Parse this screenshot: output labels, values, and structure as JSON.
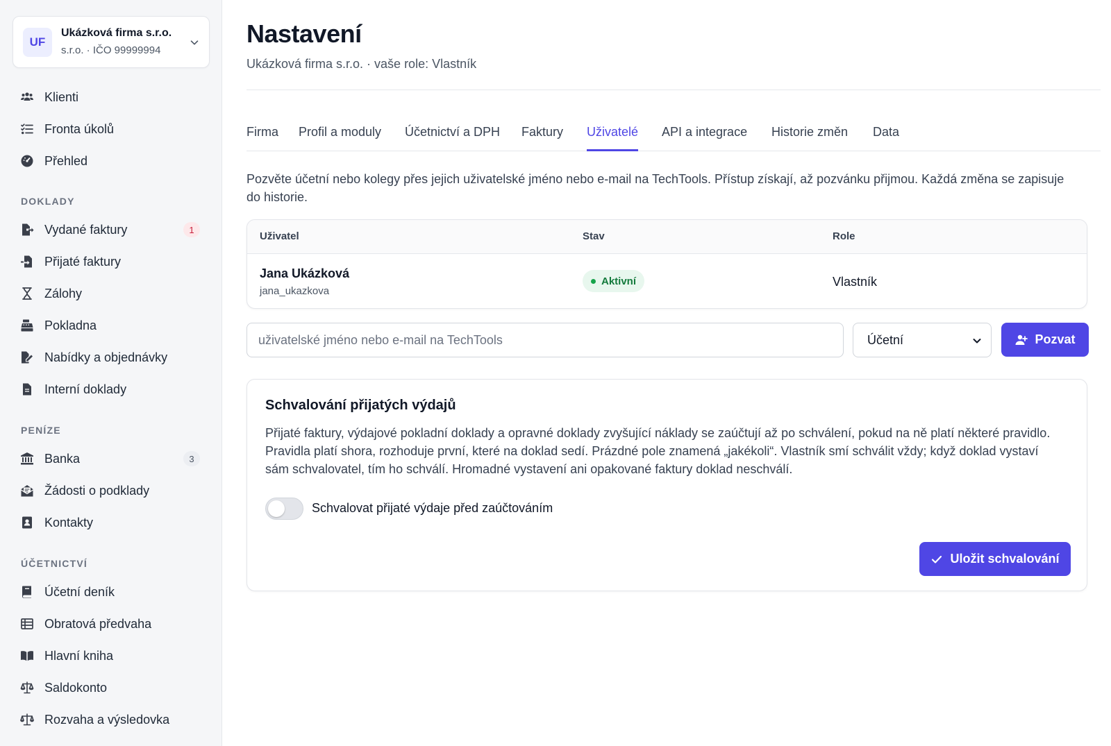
{
  "org": {
    "initials": "UF",
    "name": "Ukázková firma s.r.o.",
    "subtitle": "s.r.o. · IČO 99999994"
  },
  "sidebar": {
    "top_items": [
      {
        "label": "Klienti",
        "icon": "users-icon"
      },
      {
        "label": "Fronta úkolů",
        "icon": "task-list-icon"
      },
      {
        "label": "Přehled",
        "icon": "gauge-icon"
      }
    ],
    "sections": [
      {
        "title": "DOKLADY",
        "items": [
          {
            "label": "Vydané faktury",
            "icon": "file-export-icon",
            "badge": "1"
          },
          {
            "label": "Přijaté faktury",
            "icon": "file-import-icon"
          },
          {
            "label": "Zálohy",
            "icon": "hourglass-icon"
          },
          {
            "label": "Pokladna",
            "icon": "cash-register-icon"
          },
          {
            "label": "Nabídky a objednávky",
            "icon": "file-signature-icon"
          },
          {
            "label": "Interní doklady",
            "icon": "document-icon"
          }
        ]
      },
      {
        "title": "PENÍZE",
        "items": [
          {
            "label": "Banka",
            "icon": "bank-icon",
            "badge": "3"
          },
          {
            "label": "Žádosti o podklady",
            "icon": "envelope-open-icon"
          },
          {
            "label": "Kontakty",
            "icon": "contact-book-icon"
          }
        ]
      },
      {
        "title": "ÚČETNICTVÍ",
        "items": [
          {
            "label": "Účetní deník",
            "icon": "journal-icon"
          },
          {
            "label": "Obratová předvaha",
            "icon": "table-icon"
          },
          {
            "label": "Hlavní kniha",
            "icon": "book-open-icon"
          },
          {
            "label": "Saldokonto",
            "icon": "scale-icon"
          },
          {
            "label": "Rozvaha a výsledovka",
            "icon": "scale-balanced-icon"
          }
        ]
      }
    ]
  },
  "page": {
    "title": "Nastavení",
    "subtitle": "Ukázková firma s.r.o. · vaše role: Vlastník"
  },
  "tabs": [
    {
      "label": "Firma",
      "active": false
    },
    {
      "label": "Profil a moduly",
      "active": false
    },
    {
      "label": "Účetnictví a DPH",
      "active": false
    },
    {
      "label": "Faktury",
      "active": false
    },
    {
      "label": "Uživatelé",
      "active": true
    },
    {
      "label": "API a integrace",
      "active": false
    },
    {
      "label": "Historie změn",
      "active": false
    },
    {
      "label": "Data",
      "active": false
    }
  ],
  "intro": "Pozvěte účetní nebo kolegy přes jejich uživatelské jméno nebo e-mail na TechTools. Přístup získají, až pozvánku přijmou. Každá změna se zapisuje do historie.",
  "users_table": {
    "columns": [
      "Uživatel",
      "Stav",
      "Role"
    ],
    "rows": [
      {
        "name": "Jana Ukázková",
        "username": "jana_ukazkova",
        "status": "Aktivní",
        "role": "Vlastník"
      }
    ]
  },
  "invite": {
    "placeholder": "uživatelské jméno nebo e-mail na TechTools",
    "value": "",
    "role_selected": "Účetní",
    "button_label": "Pozvat"
  },
  "approval": {
    "title": "Schvalování přijatých výdajů",
    "text": "Přijaté faktury, výdajové pokladní doklady a opravné doklady zvyšující náklady se zaúčtují až po schválení, pokud na ně platí některé pravidlo. Pravidla platí shora, rozhoduje první, které na doklad sedí. Prázdné pole znamená „jakékoli“. Vlastník smí schválit vždy; když doklad vystaví sám schvalovatel, tím ho schválí. Hromadné vystavení ani opakované faktury doklad neschválí.",
    "toggle_label": "Schvalovat přijaté výdaje před zaúčtováním",
    "toggle_on": false,
    "save_label": "Uložit schvalování"
  },
  "colors": {
    "accent": "#4f46e5",
    "status_active_bg": "#e8f7ee",
    "status_active_text": "#137a3c",
    "badge_red": "#c81e3a"
  }
}
